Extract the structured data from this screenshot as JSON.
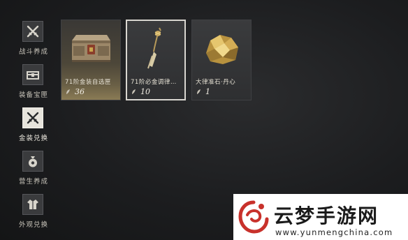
{
  "sidebar": {
    "items": [
      {
        "label": "战斗养成",
        "icon": "crossed-swords-icon",
        "active": false
      },
      {
        "label": "装备宝匣",
        "icon": "chest-icon",
        "active": false
      },
      {
        "label": "金装兑换",
        "icon": "crossed-swords-icon",
        "active": true
      },
      {
        "label": "营生养成",
        "icon": "money-bag-icon",
        "active": false
      },
      {
        "label": "外观兑换",
        "icon": "robe-icon",
        "active": false
      }
    ]
  },
  "items": [
    {
      "name": "71阶金装自选匣",
      "quantity": "36",
      "icon": "gold-chest-icon",
      "selected": false
    },
    {
      "name": "71阶必金调律…",
      "quantity": "10",
      "icon": "tassel-ornament-icon",
      "selected": true
    },
    {
      "name": "大律准石·丹心",
      "quantity": "1",
      "icon": "gold-ore-icon",
      "selected": false
    }
  ],
  "watermark": {
    "text": "云梦手游网",
    "url": "www.yunmengchina.com",
    "accent": "#c8312b"
  },
  "colors": {
    "background": "#1c1d1f",
    "active_tab": "#e7e4dc",
    "card_gold": "#8a7b55"
  }
}
